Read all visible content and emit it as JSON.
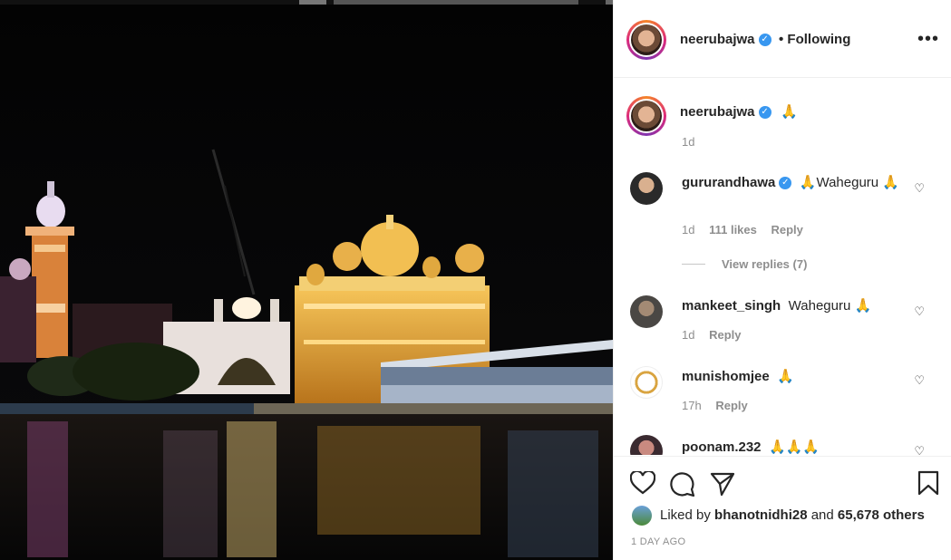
{
  "post": {
    "author": "neerubajwa",
    "follow_status": "• Following",
    "more_icon": "more-horizontal-icon",
    "caption": "🙏",
    "caption_age": "1d"
  },
  "comments": [
    {
      "user": "gururandhawa",
      "verified": true,
      "text": "🙏Waheguru 🙏",
      "age": "1d",
      "likes": "111 likes",
      "reply": "Reply",
      "view_replies": "View replies (7)"
    },
    {
      "user": "mankeet_singh",
      "verified": false,
      "text": "Waheguru 🙏",
      "age": "1d",
      "reply": "Reply"
    },
    {
      "user": "munishomjee",
      "verified": false,
      "text": "🙏",
      "age": "17h",
      "reply": "Reply"
    },
    {
      "user": "poonam.232",
      "verified": false,
      "text": "🙏🙏🙏"
    }
  ],
  "likes": {
    "prefix": "Liked by",
    "user": "bhanotnidhi28",
    "and": "and",
    "others": "65,678 others"
  },
  "timestamp": "1 DAY AGO",
  "colors": {
    "verified_blue": "#3897f0",
    "text": "#262626",
    "muted": "#8e8e8e"
  }
}
